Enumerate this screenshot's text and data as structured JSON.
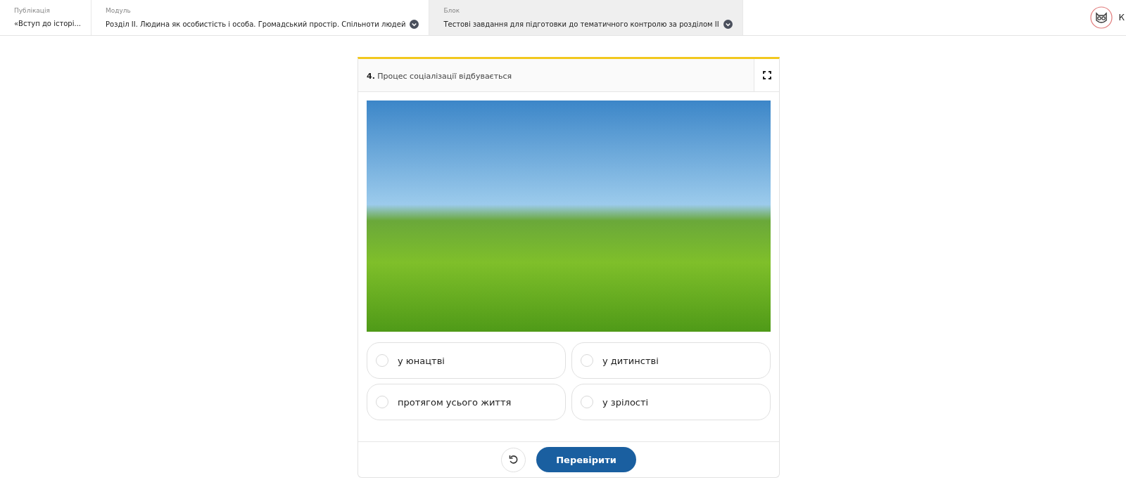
{
  "breadcrumbs": [
    {
      "label": "Публікація",
      "value": "«Вступ до історі...",
      "dropdown": false,
      "selected": false
    },
    {
      "label": "Модуль",
      "value": "Розділ II. Людина як особистість і особа. Громадський простір. Спільноти людей",
      "dropdown": true,
      "selected": false
    },
    {
      "label": "Блок",
      "value": "Тестові завдання для підготовки до тематичного контролю за розділом II",
      "dropdown": true,
      "selected": true
    }
  ],
  "user": {
    "name": "К"
  },
  "question": {
    "number": "4.",
    "text": "Процес соціалізації відбувається",
    "options": [
      {
        "text": "у юнацтві",
        "selected": false
      },
      {
        "text": "у дитинстві",
        "selected": false
      },
      {
        "text": "протягом усього життя",
        "selected": false
      },
      {
        "text": "у зрілості",
        "selected": false
      }
    ],
    "check_button": "Перевірити"
  }
}
